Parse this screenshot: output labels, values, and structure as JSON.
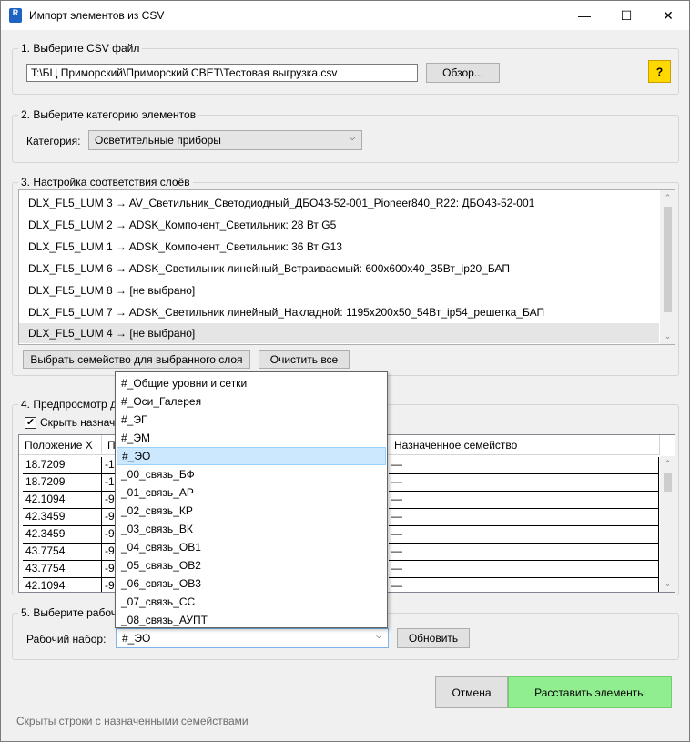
{
  "window": {
    "title": "Импорт элементов из CSV",
    "icon_letter": "R",
    "minimize_glyph": "—",
    "maximize_glyph": "☐",
    "close_glyph": "✕"
  },
  "section1": {
    "legend": "1. Выберите CSV файл",
    "path_value": "T:\\БЦ Приморский\\Приморский СВЕТ\\Тестовая выгрузка.csv",
    "browse_label": "Обзор...",
    "help_label": "?"
  },
  "section2": {
    "legend": "2. Выберите категорию элементов",
    "category_label": "Категория:",
    "category_value": "Осветительные приборы"
  },
  "section3": {
    "legend": "3. Настройка соответствия слоёв",
    "mappings": [
      "DLX_FL5_LUM 3 → AV_Светильник_Светодиодный_ДБО43-52-001_Pioneer840_R22: ДБО43-52-001",
      "DLX_FL5_LUM 2 → ADSK_Компонент_Светильник: 28 Вт G5",
      "DLX_FL5_LUM 1 → ADSK_Компонент_Светильник: 36 Вт G13",
      "DLX_FL5_LUM 6 → ADSK_Светильник линейный_Встраиваемый: 600х600х40_35Вт_ip20_БАП",
      "DLX_FL5_LUM 8 → [не выбрано]",
      "DLX_FL5_LUM 7 → ADSK_Светильник линейный_Накладной: 1195х200х50_54Вт_ip54_решетка_БАП",
      "DLX_FL5_LUM 4 → [не выбрано]"
    ],
    "select_family_label": "Выбрать семейство для выбранного слоя",
    "clear_all_label": "Очистить все"
  },
  "section4": {
    "legend": "4. Предпросмотр д",
    "hide_assigned_label": "Скрыть назнач",
    "hide_assigned_checked": true,
    "check_glyph": "✔",
    "columns": [
      "Положение X",
      "П",
      "Назначенное семейство"
    ],
    "rows": [
      [
        "18.7209",
        "-1",
        "—"
      ],
      [
        "18.7209",
        "-1",
        "—"
      ],
      [
        "42.1094",
        "-9",
        "—"
      ],
      [
        "42.3459",
        "-9",
        "—"
      ],
      [
        "42.3459",
        "-9",
        "—"
      ],
      [
        "43.7754",
        "-9",
        "—"
      ],
      [
        "43.7754",
        "-9",
        "—"
      ],
      [
        "42.1094",
        "-9",
        "—"
      ]
    ]
  },
  "section5": {
    "legend": "5. Выберите рабоч",
    "workset_label": "Рабочий набор:",
    "workset_value": "#_ЭО",
    "refresh_label": "Обновить"
  },
  "workset_dropdown": {
    "options": [
      "#_Общие уровни и сетки",
      "#_Оси_Галерея",
      "#_ЭГ",
      "#_ЭМ",
      "#_ЭО",
      "_00_связь_БФ",
      "_01_связь_АР",
      "_02_связь_КР",
      "_03_связь_ВК",
      "_04_связь_ОВ1",
      "_05_связь_ОВ2",
      "_06_связь_ОВ3",
      "_07_связь_СС",
      "_08_связь_АУПТ"
    ],
    "selected_index": 4
  },
  "footer": {
    "cancel_label": "Отмена",
    "place_label": "Расставить элементы",
    "status_text": "Скрыты строки с назначенными семействами"
  },
  "colors": {
    "help_button": "#ffd800",
    "place_button": "#90ee90",
    "dropdown_selected": "#cce8ff",
    "app_icon": "#1e63c2"
  },
  "icons": {
    "app": "revit-app-icon",
    "combo_arrow": "chevron-down-icon",
    "scroll_up": "chevron-up-icon",
    "scroll_down": "chevron-down-icon"
  }
}
